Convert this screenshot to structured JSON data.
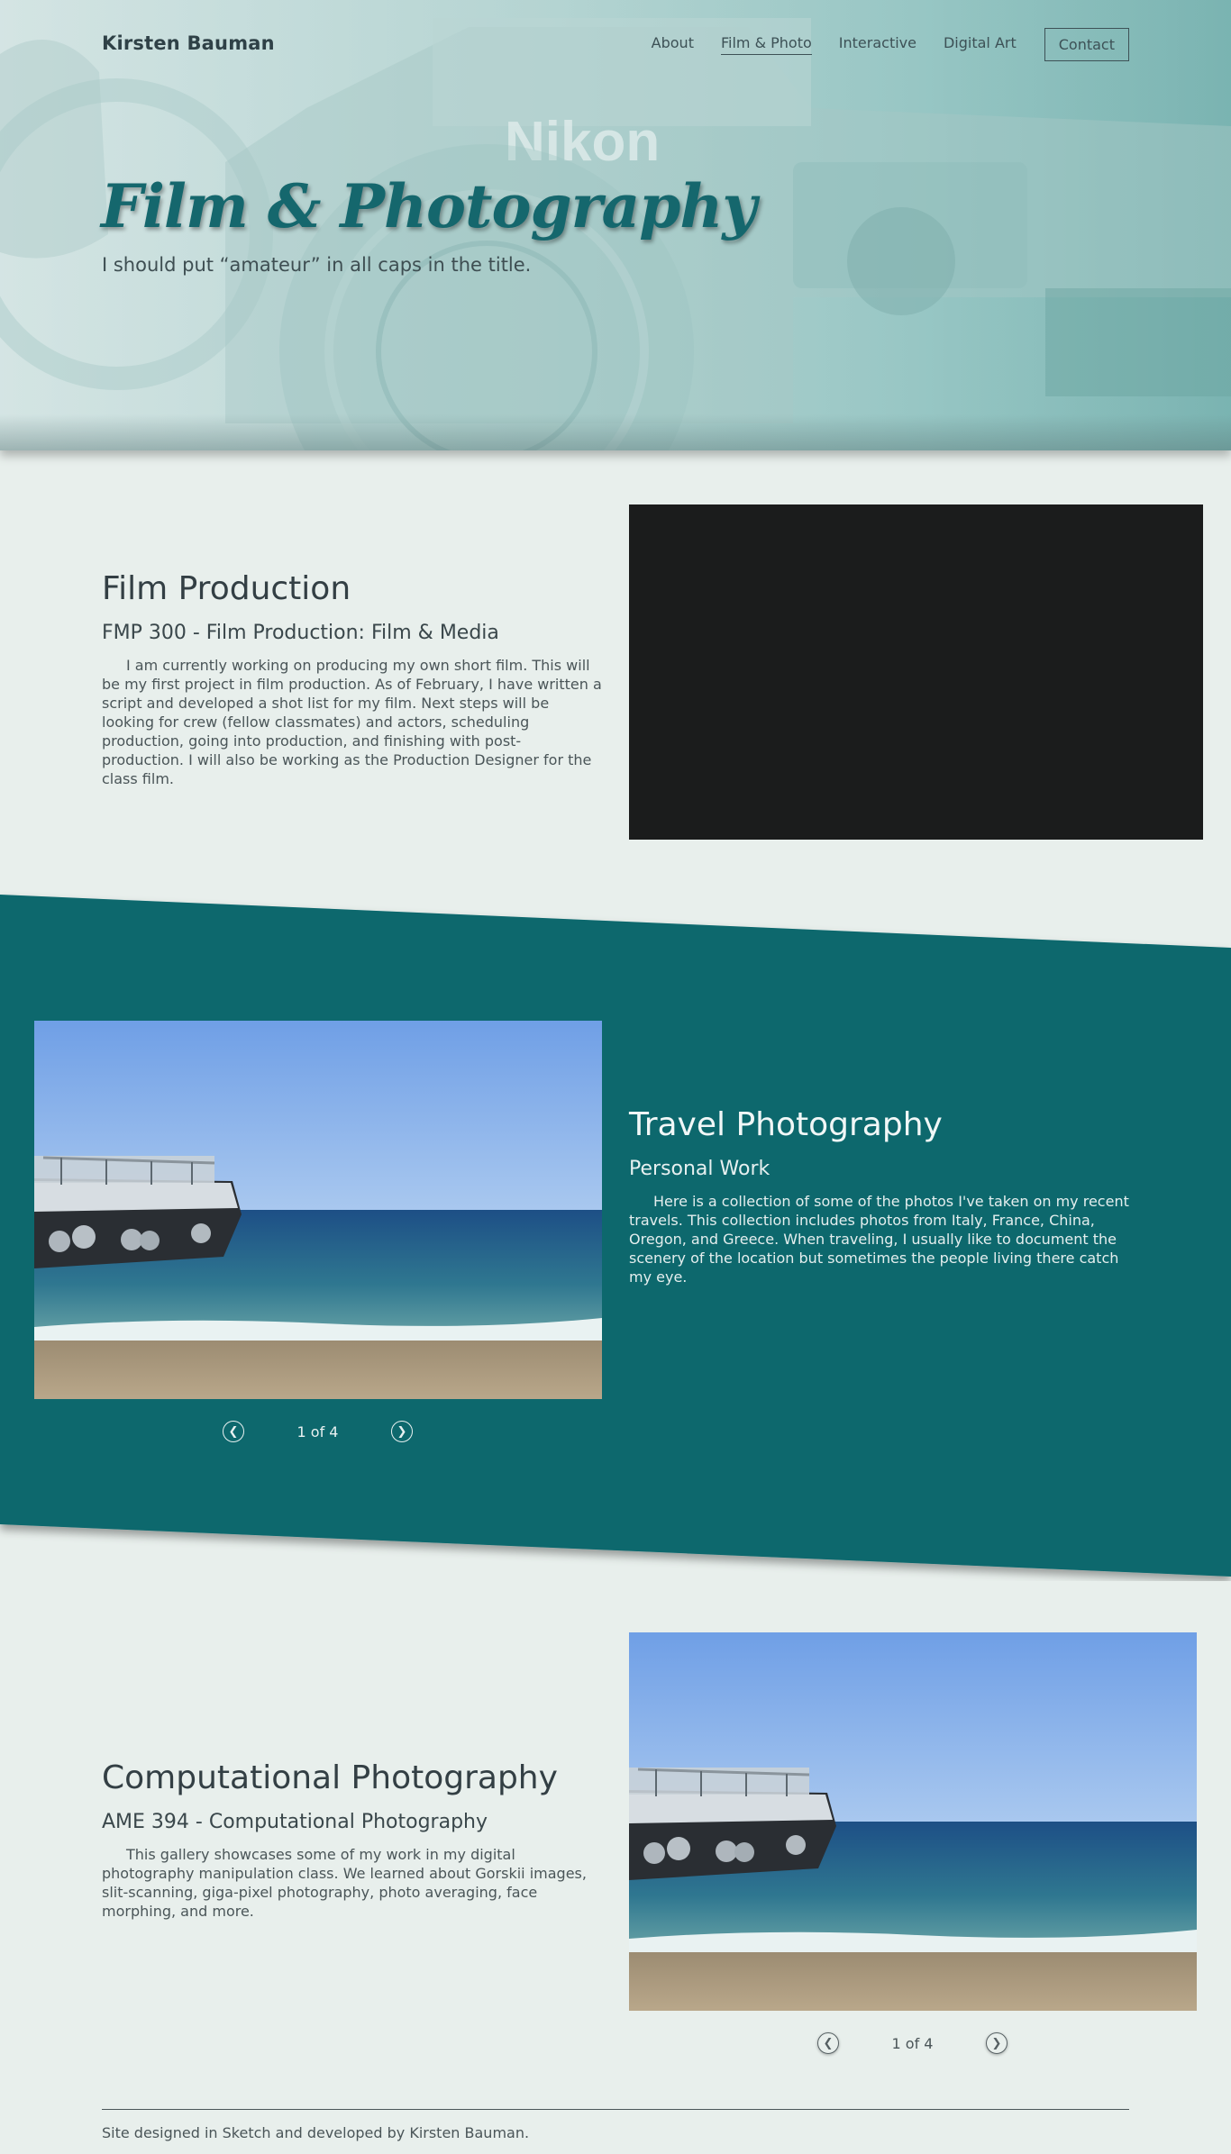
{
  "header": {
    "brand": "Kirsten Bauman",
    "nav": [
      {
        "label": "About",
        "active": false
      },
      {
        "label": "Film & Photo",
        "active": true
      },
      {
        "label": "Interactive",
        "active": false
      },
      {
        "label": "Digital Art",
        "active": false
      }
    ],
    "contact_label": "Contact"
  },
  "hero": {
    "title": "Film & Photography",
    "subtitle": "I should put “amateur” in all caps in the title.",
    "camera_brand": "Nikon"
  },
  "film": {
    "title": "Film Production",
    "course": "FMP 300 - Film Production: Film & Media",
    "description": "I am currently working on producing my own short film. This will be my first project in film production. As of February, I have written a script and developed a shot list for my film. Next steps will be looking for crew (fellow classmates) and actors, scheduling production, going into production, and finishing with post-production. I will also be working as the Production Designer for the class film."
  },
  "travel": {
    "title": "Travel Photography",
    "subtitle": "Personal Work",
    "description": "Here is a collection of some of the photos I've taken on my recent travels. This collection includes photos from Italy, France, China, Oregon, and Greece. When traveling, I usually like to document the scenery of the location but sometimes the people living there catch my eye.",
    "pager": {
      "count": "1 of 4",
      "prev_icon": "chevron-left-icon",
      "next_icon": "chevron-right-icon"
    }
  },
  "computational": {
    "title": "Computational Photography",
    "course": "AME 394 - Computational Photography",
    "description": "This gallery showcases some of my work in my digital photography manipulation class. We learned about Gorskii images, slit-scanning, giga-pixel photography, photo averaging, face morphing, and more.",
    "pager": {
      "count": "1 of 4",
      "prev_icon": "chevron-left-icon",
      "next_icon": "chevron-right-icon"
    }
  },
  "footer": {
    "text": "Site designed in Sketch and developed by Kirsten Bauman."
  },
  "colors": {
    "background": "#e8efec",
    "accent_teal": "#08676d",
    "title_teal": "#15676d",
    "video_placeholder": "#1b1c1c"
  }
}
